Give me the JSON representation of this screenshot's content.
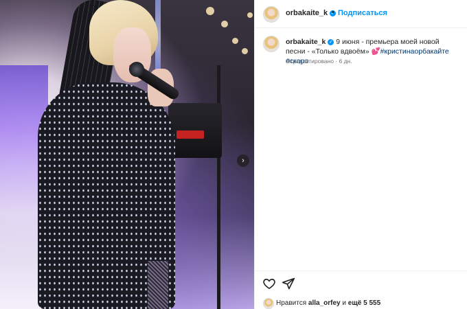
{
  "post": {
    "username": "orbakaite_k",
    "verified_mark": "✓",
    "dot": "•",
    "follow_label": "Подписаться",
    "next_arrow": "›"
  },
  "caption": {
    "username": "orbakaite_k",
    "text_1": "9 июня - премьера моей новой песни - «Только вдвоём»",
    "emoji": "💕",
    "hashtag_1": "#кристинаорбакайте",
    "hashtag_2": "#скоро",
    "edited": "Отредактировано · 6 дн."
  },
  "actions": {
    "like_icon": "heart-outline",
    "share_icon": "paper-plane"
  },
  "likes": {
    "prefix": "Нравится",
    "user": "alla_orfey",
    "middle": "и",
    "rest": "ещё 5 555"
  },
  "colors": {
    "accent": "#0095f6",
    "hashtag": "#00376b",
    "text": "#262626",
    "muted": "#737373"
  }
}
